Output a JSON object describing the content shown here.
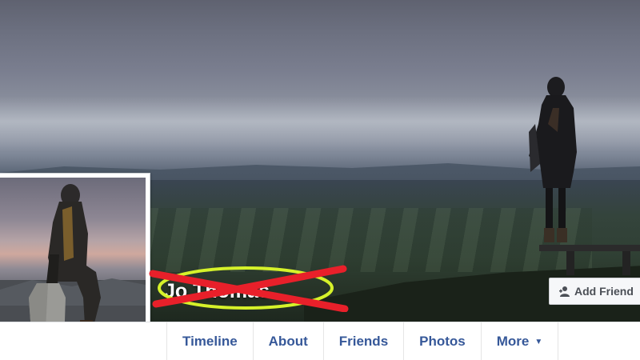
{
  "profile": {
    "name": "Jo Thomas",
    "name_redacted": true
  },
  "actions": {
    "add_friend_label": "Add Friend",
    "add_friend_icon": "add-person-icon"
  },
  "tabs": [
    {
      "label": "Timeline"
    },
    {
      "label": "About"
    },
    {
      "label": "Friends"
    },
    {
      "label": "Photos"
    },
    {
      "label": "More",
      "icon": "caret-down-icon"
    }
  ],
  "annotation": {
    "ellipse_color": "#d6f22a",
    "cross_color": "#e8202a"
  },
  "colors": {
    "link_blue": "#365899",
    "button_text": "#4b4f56"
  }
}
